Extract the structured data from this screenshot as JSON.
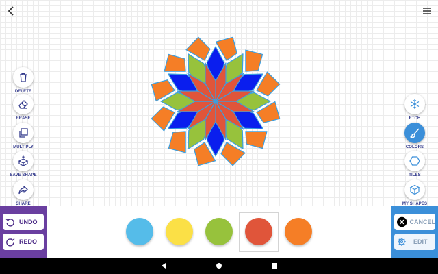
{
  "toolbar_left": {
    "delete_label": "DELETE",
    "erase_label": "ERASE",
    "multiply_label": "MULTIPLY",
    "save_shape_label": "SAVE SHAPE",
    "share_label": "SHARE"
  },
  "toolbar_right": {
    "etch_label": "ETCH",
    "colors_label": "COLORS",
    "tiles_label": "TILES",
    "my_shapes_label": "MY SHAPES",
    "active_tool": "colors"
  },
  "history": {
    "undo_label": "UNDO",
    "redo_label": "REDO"
  },
  "actions": {
    "cancel_label": "CANCEL",
    "edit_label": "EDIT"
  },
  "palette": {
    "colors": [
      "#55bce9",
      "#fbe046",
      "#97c23c",
      "#e0553a",
      "#f57e26"
    ],
    "selected_index": 3
  },
  "shape_colors": {
    "outer_kite": "#f57e26",
    "blue_rhombus": "#0a1eee",
    "green_rhombus": "#97c23c",
    "inner_red": "#e0553a",
    "stroke": "#3b9fe0"
  },
  "icons": {
    "top_left": "back-arrow-icon",
    "top_right": "hamburger-menu-icon",
    "delete": "trash-icon",
    "erase": "eraser-icon",
    "multiply": "copy-icon",
    "save_shape": "cube-plus-icon",
    "share": "share-arrow-icon",
    "etch": "snowflake-icon",
    "colors": "paintbrush-icon",
    "tiles": "hexagon-icon",
    "my_shapes": "cube-icon",
    "undo": "undo-icon",
    "redo": "redo-icon",
    "cancel": "close-circle-icon",
    "edit": "gear-icon"
  }
}
